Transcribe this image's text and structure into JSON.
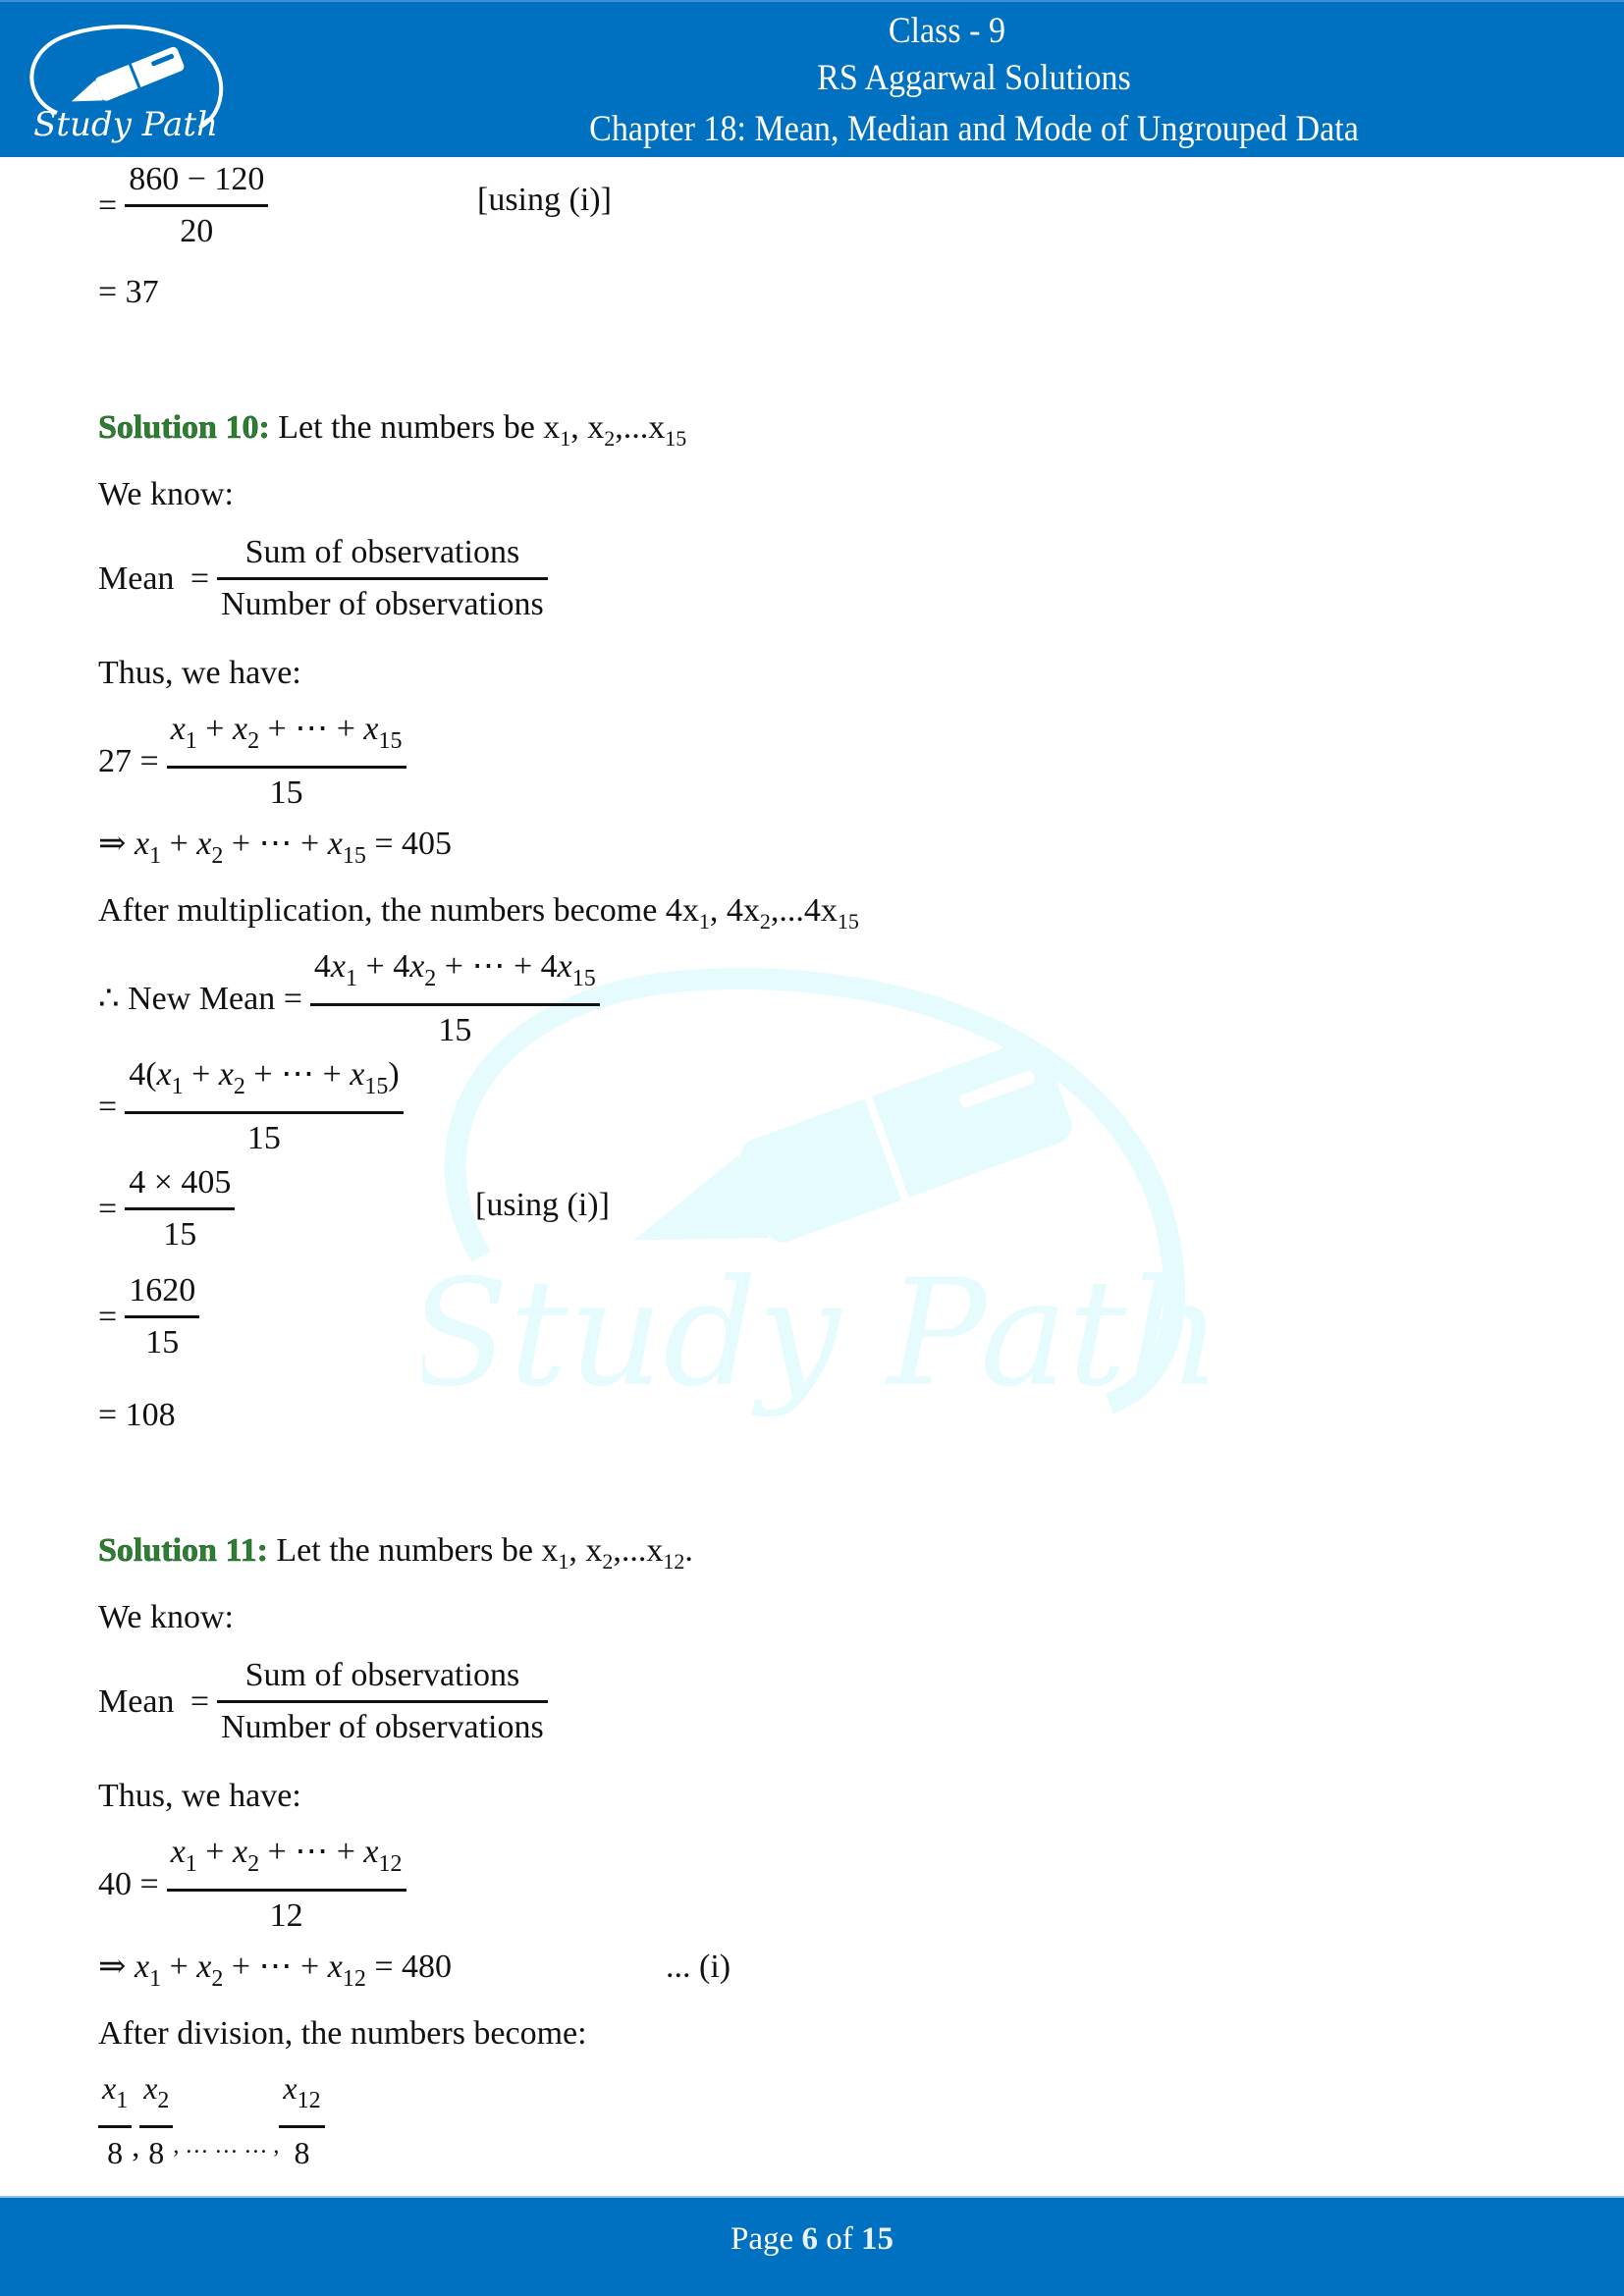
{
  "header": {
    "logo_text": "Study Path",
    "line1": "Class - 9",
    "line2": "RS Aggarwal Solutions",
    "line3": "Chapter 18: Mean, Median and Mode of Ungrouped Data"
  },
  "continuation": {
    "eq1_num": "860 − 120",
    "eq1_den": "20",
    "eq1_note": "[using (i)]",
    "eq2": "= 37"
  },
  "solution10": {
    "label": "Solution 10:",
    "intro": "Let the numbers be x",
    "intro_parts": [
      "1",
      ", x",
      "2",
      ",...x",
      "15"
    ],
    "we_know": "We know:",
    "mean_label": "Mean",
    "mean_num": "Sum of observations",
    "mean_den": "Number of observations",
    "thus": "Thus, we have:",
    "given_mean": "27 =",
    "sum_den": "15",
    "implies": "⇒",
    "sum_result": "= 405",
    "after": "After multiplication, the numbers become 4x",
    "after_parts": [
      "1",
      ", 4x",
      "2",
      ",...4x",
      "15"
    ],
    "therefore_label": "∴ New Mean =",
    "new_mean_den": "15",
    "step2_den": "15",
    "step3_num": "4 × 405",
    "step3_den": "15",
    "step3_note": "[using (i)]",
    "step4_num": "1620",
    "step4_den": "15",
    "result": "= 108"
  },
  "solution11": {
    "label": "Solution 11:",
    "intro": "Let the numbers be x",
    "intro_parts": [
      "1",
      ", x",
      "2",
      ",...x",
      "12",
      "."
    ],
    "we_know": "We know:",
    "mean_label": "Mean",
    "mean_num": "Sum of observations",
    "mean_den": "Number of observations",
    "thus": "Thus, we have:",
    "given_mean": "40 =",
    "sum_den": "12",
    "implies": "⇒",
    "sum_result": "= 480",
    "sum_note": "... (i)",
    "after": "After division, the numbers become:",
    "divisor": "8",
    "ellipsis": ", … … … ,"
  },
  "footer": {
    "page_prefix": "Page",
    "page_current": "6",
    "page_of": "of",
    "page_total": "15"
  },
  "colors": {
    "brand_blue": "#0070c0",
    "solution_green": "#2e7d32",
    "watermark": "#e6fbfd"
  }
}
